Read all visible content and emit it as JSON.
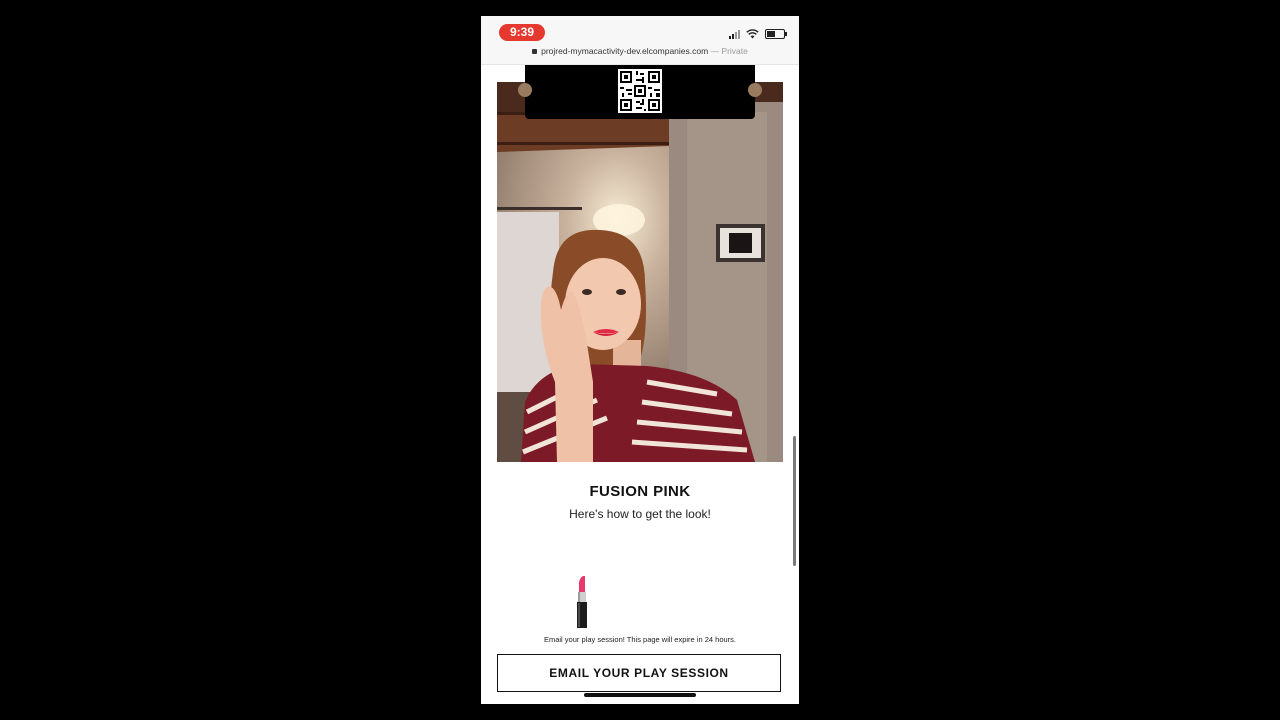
{
  "status_bar": {
    "time": "9:39",
    "time_color": "#e5392f"
  },
  "browser": {
    "url": "projred-mymacactivity-dev.elcompanies.com",
    "url_suffix": " — Private"
  },
  "product": {
    "name": "FUSION PINK",
    "tagline": "Here's how to get the look!",
    "shade_color": "#e8386d"
  },
  "email_section": {
    "note": "Email your play session! This page will expire in 24 hours.",
    "button_label": "EMAIL YOUR PLAY SESSION"
  },
  "icons": [
    "lock-icon",
    "signal-icon",
    "wifi-icon",
    "battery-icon",
    "qr-code-icon",
    "lipstick-icon"
  ]
}
